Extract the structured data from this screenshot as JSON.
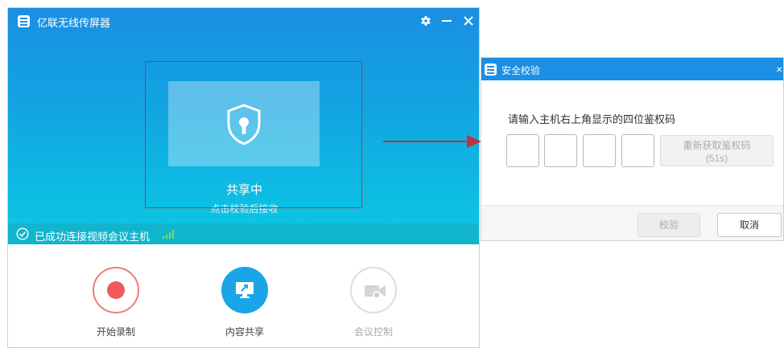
{
  "main_window": {
    "title": "亿联无线传屏器",
    "icons": {
      "app": "app-logo-icon",
      "settings": "gear-icon",
      "minimize": "minimize-icon",
      "close": "close-icon"
    },
    "share": {
      "icon": "shield-lock-icon",
      "status": "共享中",
      "hint": "点击校验后接收"
    },
    "connection": {
      "icon": "check-circle-icon",
      "text": "已成功连接视频会议主机",
      "signal_icon": "signal-bars-icon"
    },
    "actions": [
      {
        "label": "开始录制",
        "icon": "record-icon",
        "enabled": true
      },
      {
        "label": "内容共享",
        "icon": "screen-share-icon",
        "enabled": true
      },
      {
        "label": "会议控制",
        "icon": "meeting-control-icon",
        "enabled": false
      }
    ]
  },
  "dialog": {
    "title": "安全校验",
    "close_icon": "close-icon",
    "prompt": "请输入主机右上角显示的四位鉴权码",
    "code_values": [
      "",
      "",
      "",
      ""
    ],
    "refresh_label": "重新获取鉴权码",
    "refresh_countdown": "(51s)",
    "verify_label": "校验",
    "cancel_label": "取消"
  },
  "colors": {
    "accent": "#1a8fe3",
    "highlight_border": "#c0323c",
    "record_red": "#ef5a5a",
    "status_bar": "#11b5cc"
  }
}
